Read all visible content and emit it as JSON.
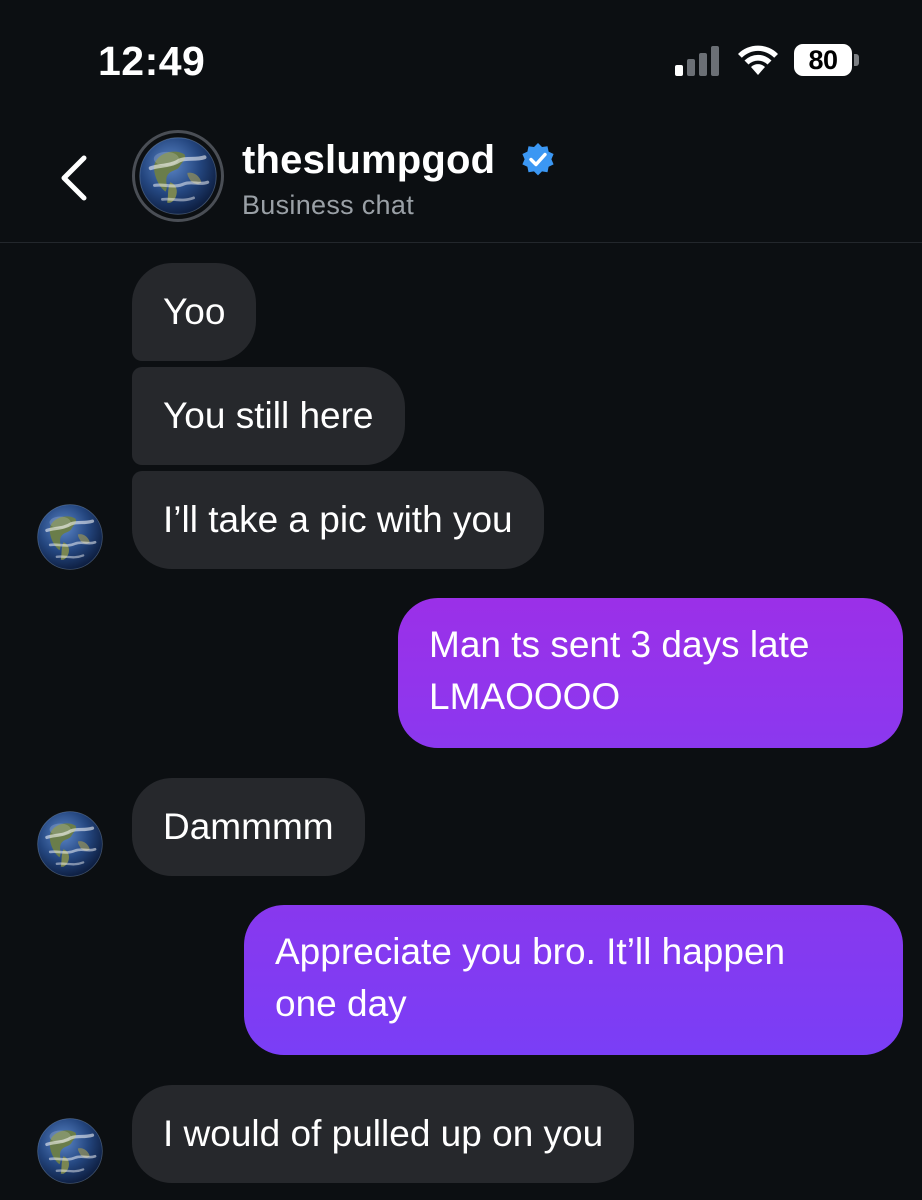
{
  "status_bar": {
    "time": "12:49",
    "battery": "80",
    "icons": [
      "signal-icon",
      "wifi-icon",
      "battery-icon"
    ]
  },
  "header": {
    "back_icon": "chevron-left-icon",
    "avatar_icon": "globe-avatar-icon",
    "name": "theslumpgod",
    "verified_icon": "verified-badge-icon",
    "subtitle": "Business chat"
  },
  "messages": [
    {
      "sender": "them",
      "text": "Yoo"
    },
    {
      "sender": "them",
      "text": "You still here"
    },
    {
      "sender": "them",
      "text": "I’ll take a pic with you"
    },
    {
      "sender": "me",
      "line1": "Man ts sent 3 days late",
      "line2": "LMAOOOO"
    },
    {
      "sender": "them",
      "text": "Dammmm"
    },
    {
      "sender": "me",
      "line1": "Appreciate you bro. It’ll happen",
      "line2": "one day"
    },
    {
      "sender": "them",
      "text": "I would of pulled up on you"
    }
  ],
  "colors": {
    "background": "#0c0f12",
    "incoming_bubble": "#26282c",
    "outgoing_gradient_top": "#9b30e8",
    "outgoing_gradient_bottom": "#7a3ef6",
    "verified": "#3b97f3"
  }
}
